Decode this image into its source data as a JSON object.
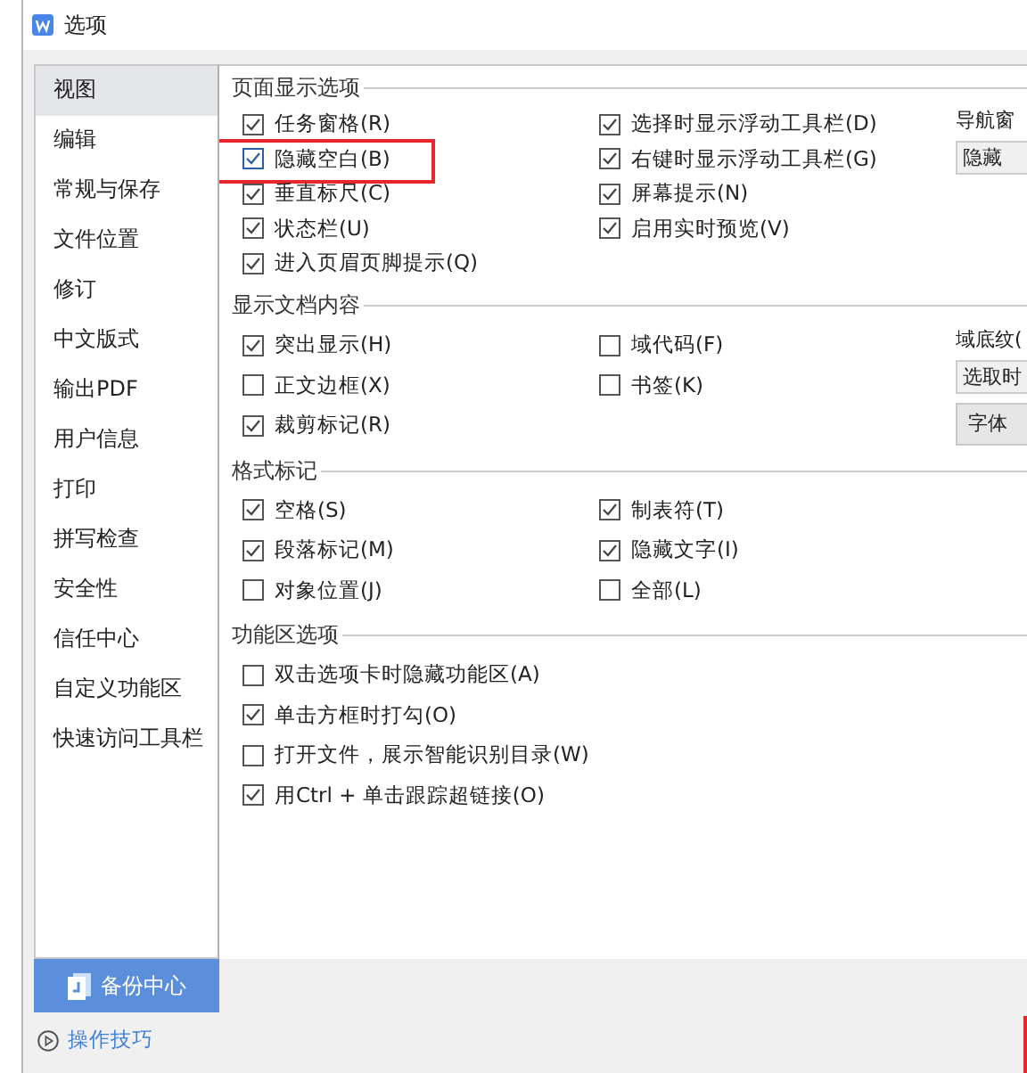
{
  "window": {
    "title": "选项"
  },
  "sidebar": {
    "items": [
      {
        "label": "视图",
        "selected": true
      },
      {
        "label": "编辑",
        "selected": false
      },
      {
        "label": "常规与保存",
        "selected": false
      },
      {
        "label": "文件位置",
        "selected": false
      },
      {
        "label": "修订",
        "selected": false
      },
      {
        "label": "中文版式",
        "selected": false
      },
      {
        "label": "输出PDF",
        "selected": false
      },
      {
        "label": "用户信息",
        "selected": false
      },
      {
        "label": "打印",
        "selected": false
      },
      {
        "label": "拼写检查",
        "selected": false
      },
      {
        "label": "安全性",
        "selected": false
      },
      {
        "label": "信任中心",
        "selected": false
      },
      {
        "label": "自定义功能区",
        "selected": false
      },
      {
        "label": "快速访问工具栏",
        "selected": false
      }
    ]
  },
  "sections": [
    {
      "title": "页面显示选项",
      "columns": [
        [
          {
            "label": "任务窗格(R)",
            "checked": true,
            "highlighted": false
          },
          {
            "label": "隐藏空白(B)",
            "checked": true,
            "highlighted": true
          },
          {
            "label": "垂直标尺(C)",
            "checked": true,
            "highlighted": false
          },
          {
            "label": "状态栏(U)",
            "checked": true,
            "highlighted": false
          },
          {
            "label": "进入页眉页脚提示(Q)",
            "checked": true,
            "highlighted": false
          }
        ],
        [
          {
            "label": "选择时显示浮动工具栏(D)",
            "checked": true,
            "highlighted": false
          },
          {
            "label": "右键时显示浮动工具栏(G)",
            "checked": true,
            "highlighted": false
          },
          {
            "label": "屏幕提示(N)",
            "checked": true,
            "highlighted": false
          },
          {
            "label": "启用实时预览(V)",
            "checked": true,
            "highlighted": false
          }
        ]
      ],
      "side": [
        {
          "kind": "label",
          "text": "导航窗"
        },
        {
          "kind": "dropdown",
          "text": "隐藏"
        }
      ]
    },
    {
      "title": "显示文档内容",
      "columns": [
        [
          {
            "label": "突出显示(H)",
            "checked": true,
            "highlighted": false
          },
          {
            "label": "正文边框(X)",
            "checked": false,
            "highlighted": false
          },
          {
            "label": "裁剪标记(R)",
            "checked": true,
            "highlighted": false
          }
        ],
        [
          {
            "label": "域代码(F)",
            "checked": false,
            "highlighted": false
          },
          {
            "label": "书签(K)",
            "checked": false,
            "highlighted": false
          }
        ]
      ],
      "side": [
        {
          "kind": "label",
          "text": "域底纹("
        },
        {
          "kind": "dropdown",
          "text": "选取时"
        },
        {
          "kind": "button",
          "text": "字体"
        }
      ]
    },
    {
      "title": "格式标记",
      "columns": [
        [
          {
            "label": "空格(S)",
            "checked": true,
            "highlighted": false
          },
          {
            "label": "段落标记(M)",
            "checked": true,
            "highlighted": false
          },
          {
            "label": "对象位置(J)",
            "checked": false,
            "highlighted": false
          }
        ],
        [
          {
            "label": "制表符(T)",
            "checked": true,
            "highlighted": false
          },
          {
            "label": "隐藏文字(I)",
            "checked": true,
            "highlighted": false
          },
          {
            "label": "全部(L)",
            "checked": false,
            "highlighted": false
          }
        ]
      ]
    },
    {
      "title": "功能区选项",
      "columns": [
        [
          {
            "label": "双击选项卡时隐藏功能区(A)",
            "checked": false,
            "highlighted": false
          },
          {
            "label": "单击方框时打勾(O)",
            "checked": true,
            "highlighted": false
          },
          {
            "label": "打开文件，展示智能识别目录(W)",
            "checked": false,
            "highlighted": false
          },
          {
            "label": "用Ctrl + 单击跟踪超链接(O)",
            "checked": true,
            "highlighted": false
          }
        ]
      ]
    }
  ],
  "footer": {
    "backup_button": "备份中心",
    "tips_link": "操作技巧",
    "edge_highlight": true
  }
}
